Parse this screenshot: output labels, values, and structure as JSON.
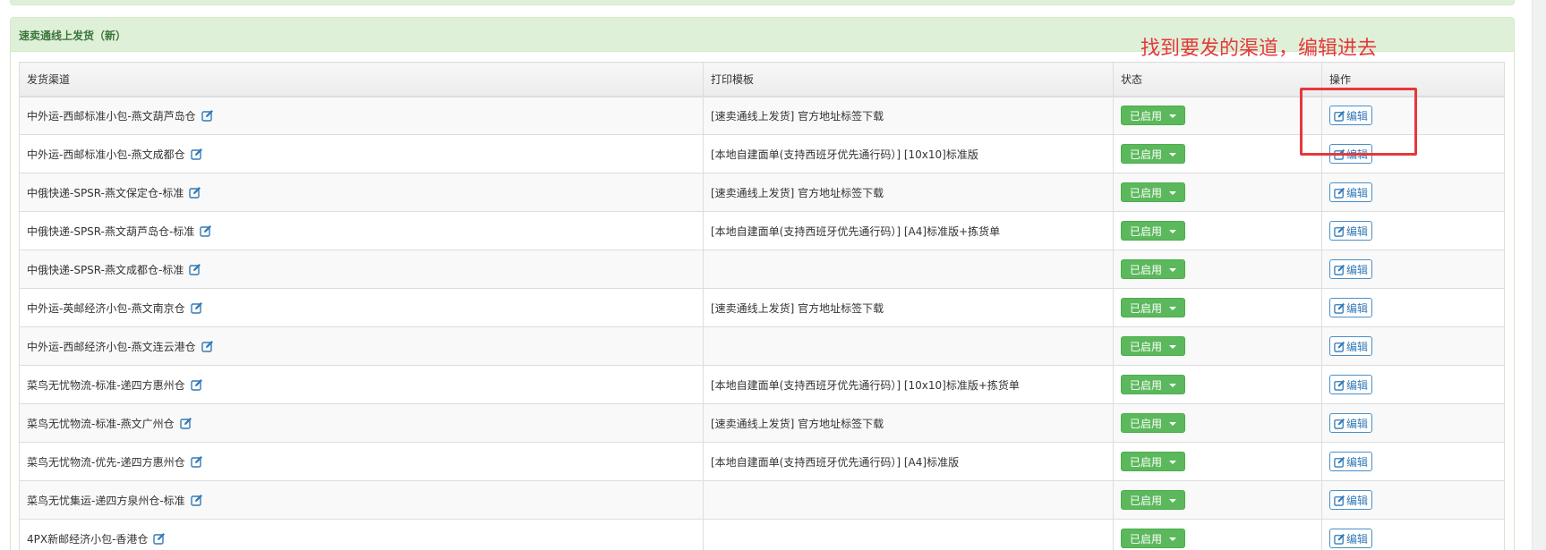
{
  "panel": {
    "title": "速卖通线上发货（新）"
  },
  "table": {
    "headers": [
      "发货渠道",
      "打印模板",
      "状态",
      "操作"
    ],
    "rows": [
      {
        "channel": "中外运-西邮标准小包-燕文葫芦岛仓",
        "template": "[速卖通线上发货] 官方地址标签下载",
        "status": "已启用",
        "action": "编辑"
      },
      {
        "channel": "中外运-西邮标准小包-燕文成都仓",
        "template": "[本地自建面单(支持西班牙优先通行码）] [10x10]标准版",
        "status": "已启用",
        "action": "编辑"
      },
      {
        "channel": "中俄快递-SPSR-燕文保定仓-标准",
        "template": "[速卖通线上发货] 官方地址标签下载",
        "status": "已启用",
        "action": "编辑"
      },
      {
        "channel": "中俄快递-SPSR-燕文葫芦岛仓-标准",
        "template": "[本地自建面单(支持西班牙优先通行码）] [A4]标准版+拣货单",
        "status": "已启用",
        "action": "编辑"
      },
      {
        "channel": "中俄快递-SPSR-燕文成都仓-标准",
        "template": "",
        "status": "已启用",
        "action": "编辑"
      },
      {
        "channel": "中外运-英邮经济小包-燕文南京仓",
        "template": "[速卖通线上发货] 官方地址标签下载",
        "status": "已启用",
        "action": "编辑"
      },
      {
        "channel": "中外运-西邮经济小包-燕文连云港仓",
        "template": "",
        "status": "已启用",
        "action": "编辑"
      },
      {
        "channel": "菜鸟无忧物流-标准-递四方惠州仓",
        "template": "[本地自建面单(支持西班牙优先通行码）] [10x10]标准版+拣货单",
        "status": "已启用",
        "action": "编辑"
      },
      {
        "channel": "菜鸟无忧物流-标准-燕文广州仓",
        "template": "[速卖通线上发货] 官方地址标签下载",
        "status": "已启用",
        "action": "编辑"
      },
      {
        "channel": "菜鸟无忧物流-优先-递四方惠州仓",
        "template": "[本地自建面单(支持西班牙优先通行码）] [A4]标准版",
        "status": "已启用",
        "action": "编辑"
      },
      {
        "channel": "菜鸟无忧集运-递四方泉州仓-标准",
        "template": "",
        "status": "已启用",
        "action": "编辑"
      },
      {
        "channel": "4PX新邮经济小包-香港仓",
        "template": "",
        "status": "已启用",
        "action": "编辑"
      }
    ]
  },
  "annotation": {
    "text": "找到要发的渠道，编辑进去",
    "color": "#e4393c"
  },
  "colors": {
    "panel_heading_bg": "#dff0d8",
    "panel_heading_text": "#3c763d",
    "status_button": "#5cb85c",
    "link": "#337ab7"
  },
  "icons": {
    "channel_edit": "edit-square-icon",
    "status_toggle": "caret-down-icon",
    "action_edit": "pencil-square-icon"
  }
}
